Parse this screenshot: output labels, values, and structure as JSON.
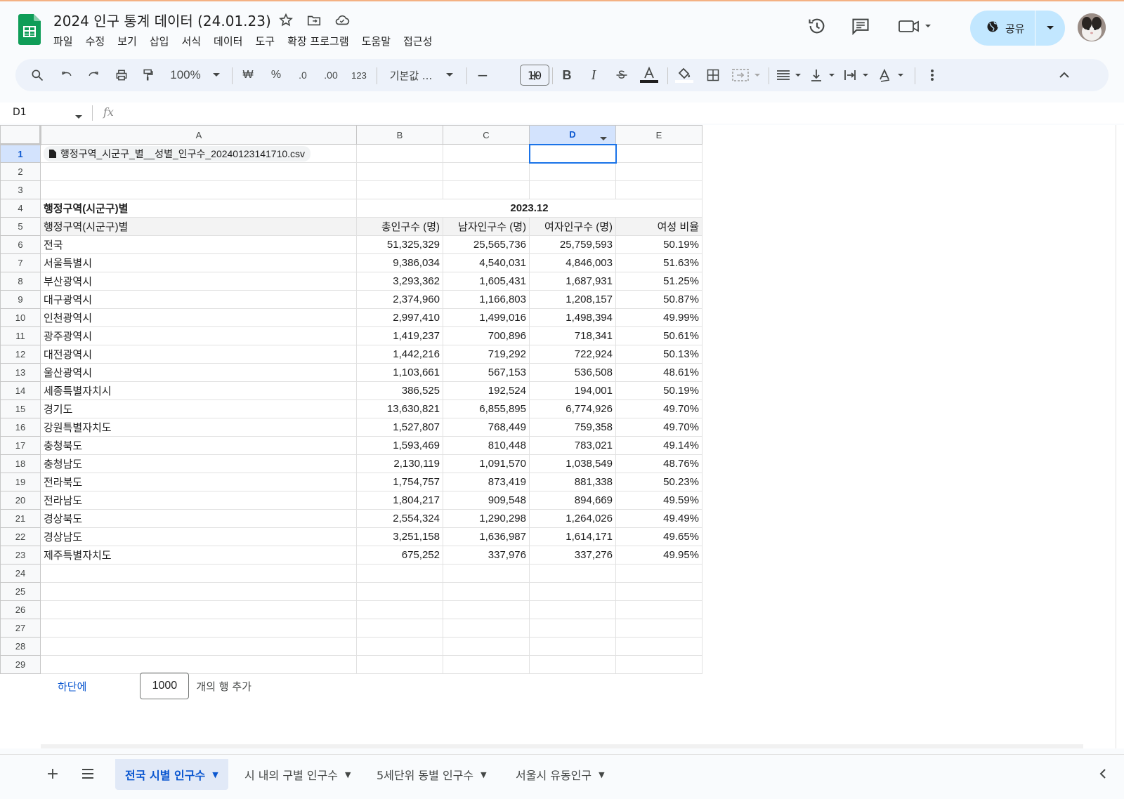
{
  "app": {
    "title": "2024 인구 통계 데이터 (24.01.23)"
  },
  "menu": [
    "파일",
    "수정",
    "보기",
    "삽입",
    "서식",
    "데이터",
    "도구",
    "확장 프로그램",
    "도움말",
    "접근성"
  ],
  "header": {
    "share_label": "공유"
  },
  "toolbar": {
    "zoom": "100%",
    "currency": "₩",
    "percent": "%",
    "dec_minus": ".0",
    "dec_plus": ".00",
    "number_format": "123",
    "font": "기본값 ...",
    "font_size": "10",
    "bold": "B",
    "italic": "I"
  },
  "formula_bar": {
    "name_box": "D1",
    "fx": "fx",
    "value": ""
  },
  "columns": [
    "A",
    "B",
    "C",
    "D",
    "E"
  ],
  "selected_column": "D",
  "selected_cell": "D1",
  "cells": {
    "a1_file": "행정구역_시군구_별__성별_인구수_20240123141710.csv",
    "a4": "행정구역(시군구)별",
    "bcde4": "2023.12",
    "a5": "행정구역(시군구)별",
    "b5": "총인구수 (명)",
    "c5": "남자인구수 (명)",
    "d5": "여자인구수 (명)",
    "e5": "여성 비율"
  },
  "rows": [
    [
      "전국",
      "51,325,329",
      "25,565,736",
      "25,759,593",
      "50.19%"
    ],
    [
      "서울특별시",
      "9,386,034",
      "4,540,031",
      "4,846,003",
      "51.63%"
    ],
    [
      "부산광역시",
      "3,293,362",
      "1,605,431",
      "1,687,931",
      "51.25%"
    ],
    [
      "대구광역시",
      "2,374,960",
      "1,166,803",
      "1,208,157",
      "50.87%"
    ],
    [
      "인천광역시",
      "2,997,410",
      "1,499,016",
      "1,498,394",
      "49.99%"
    ],
    [
      "광주광역시",
      "1,419,237",
      "700,896",
      "718,341",
      "50.61%"
    ],
    [
      "대전광역시",
      "1,442,216",
      "719,292",
      "722,924",
      "50.13%"
    ],
    [
      "울산광역시",
      "1,103,661",
      "567,153",
      "536,508",
      "48.61%"
    ],
    [
      "세종특별자치시",
      "386,525",
      "192,524",
      "194,001",
      "50.19%"
    ],
    [
      "경기도",
      "13,630,821",
      "6,855,895",
      "6,774,926",
      "49.70%"
    ],
    [
      "강원특별자치도",
      "1,527,807",
      "768,449",
      "759,358",
      "49.70%"
    ],
    [
      "충청북도",
      "1,593,469",
      "810,448",
      "783,021",
      "49.14%"
    ],
    [
      "충청남도",
      "2,130,119",
      "1,091,570",
      "1,038,549",
      "48.76%"
    ],
    [
      "전라북도",
      "1,754,757",
      "873,419",
      "881,338",
      "50.23%"
    ],
    [
      "전라남도",
      "1,804,217",
      "909,548",
      "894,669",
      "49.59%"
    ],
    [
      "경상북도",
      "2,554,324",
      "1,290,298",
      "1,264,026",
      "49.49%"
    ],
    [
      "경상남도",
      "3,251,158",
      "1,636,987",
      "1,614,171",
      "49.65%"
    ],
    [
      "제주특별자치도",
      "675,252",
      "337,976",
      "337,276",
      "49.95%"
    ]
  ],
  "empty_rows_count": 6,
  "add_rows": {
    "link": "하단에",
    "count": "1000",
    "label": "개의 행 추가"
  },
  "tabs": [
    {
      "label": "전국 시별 인구수",
      "active": true
    },
    {
      "label": "시 내의 구별 인구수",
      "active": false
    },
    {
      "label": "5세단위 동별 인구수",
      "active": false
    },
    {
      "label": "서울시 유동인구",
      "active": false
    }
  ],
  "colors": {
    "accent": "#0b57d0",
    "selection": "#1a73e8",
    "share_bg": "#c2e7ff",
    "sheets_green": "#0f9d58"
  }
}
